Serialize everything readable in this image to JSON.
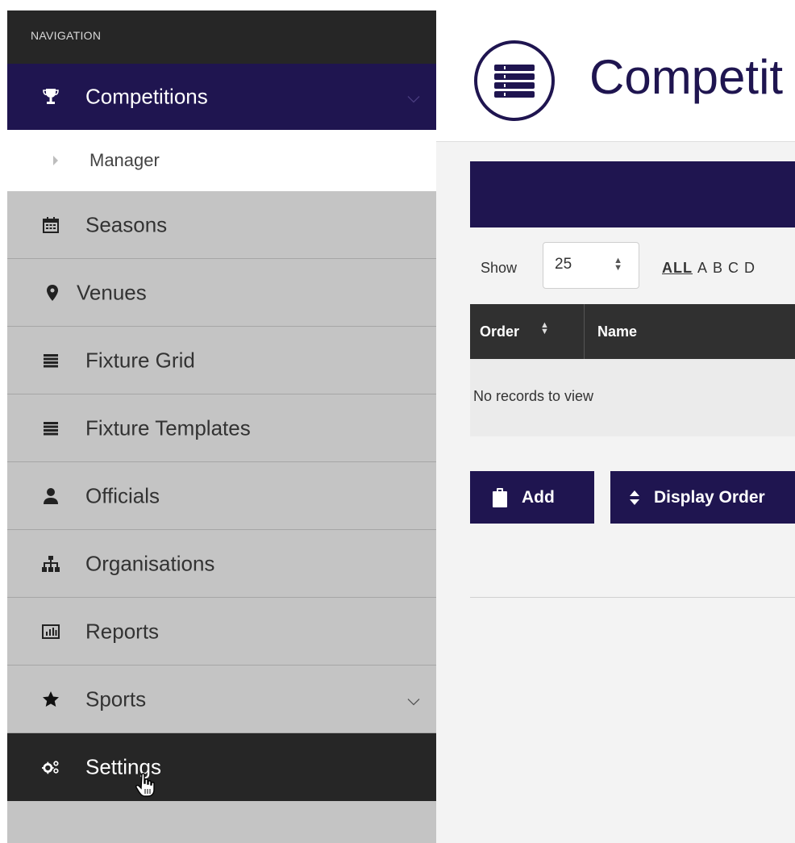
{
  "sidebar": {
    "header": "NAVIGATION",
    "items": [
      {
        "label": "Competitions",
        "icon": "trophy-icon",
        "state": "active",
        "expandable": true
      },
      {
        "label": "Manager",
        "icon": "caret-right-icon",
        "state": "sub"
      },
      {
        "label": "Seasons",
        "icon": "calendar-icon"
      },
      {
        "label": "Venues",
        "icon": "map-marker-icon"
      },
      {
        "label": "Fixture Grid",
        "icon": "list-icon"
      },
      {
        "label": "Fixture Templates",
        "icon": "list-icon"
      },
      {
        "label": "Officials",
        "icon": "user-icon"
      },
      {
        "label": "Organisations",
        "icon": "sitemap-icon"
      },
      {
        "label": "Reports",
        "icon": "bar-chart-icon"
      },
      {
        "label": "Sports",
        "icon": "star-icon",
        "expandable": true
      },
      {
        "label": "Settings",
        "icon": "cogs-icon",
        "state": "hover"
      }
    ]
  },
  "main": {
    "title": "Competit",
    "show_label": "Show",
    "page_size": "25",
    "alpha_all": "ALL",
    "alpha_letters": [
      "A",
      "B",
      "C",
      "D"
    ],
    "columns": [
      "Order",
      "Name"
    ],
    "empty_message": "No records to view",
    "buttons": {
      "add": "Add",
      "display_order": "Display Order"
    }
  },
  "colors": {
    "brand": "#1f1550",
    "sidebar_bg": "#c4c4c4",
    "dark": "#262626"
  }
}
